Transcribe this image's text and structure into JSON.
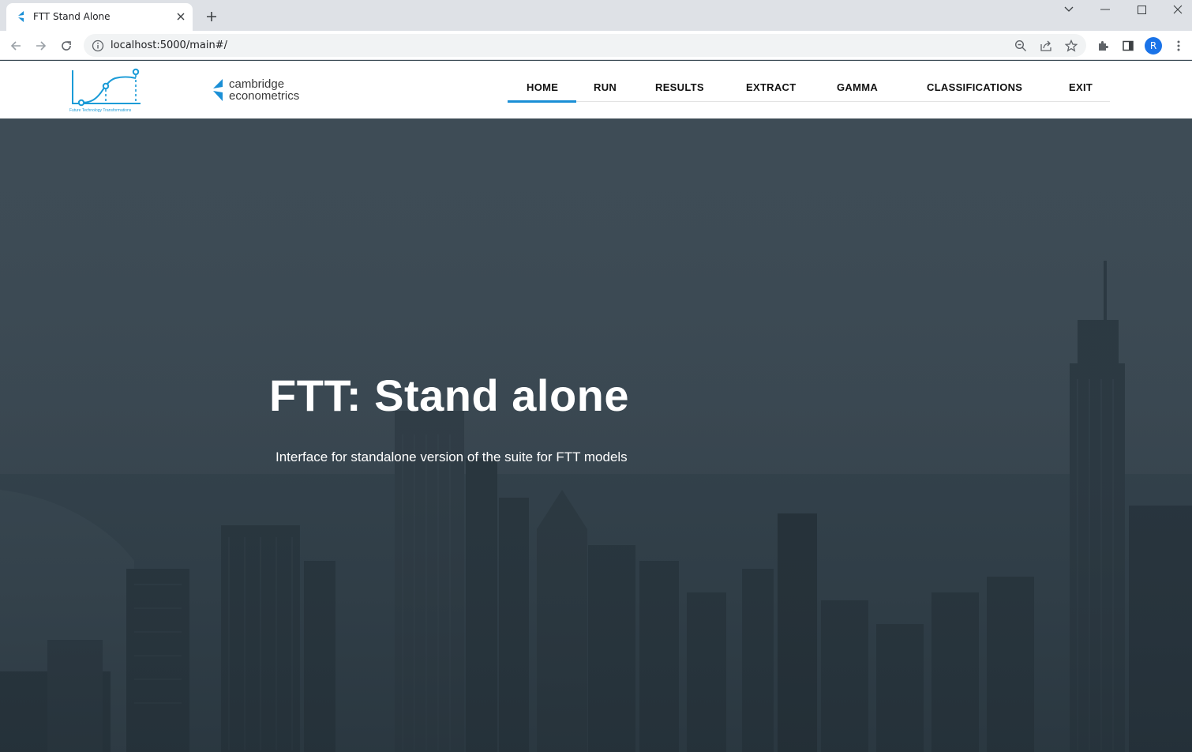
{
  "browser": {
    "tab_title": "FTT Stand Alone",
    "url": "localhost:5000/main#/",
    "profile_initial": "R"
  },
  "header": {
    "ftt_logo_caption": "Future Technology Transformations",
    "partner_logo_line1": "cambridge",
    "partner_logo_line2": "econometrics",
    "nav": {
      "home": "HOME",
      "run": "RUN",
      "results": "RESULTS",
      "extract": "EXTRACT",
      "gamma": "GAMMA",
      "classifications": "CLASSIFICATIONS",
      "exit": "EXIT"
    },
    "active_nav": "HOME",
    "accent_color": "#1a8fd6"
  },
  "hero": {
    "title": "FTT: Stand alone",
    "subtitle": "Interface for standalone version of the suite for FTT models",
    "overlay_color": "#3d4b55"
  },
  "icons": {
    "tab": [
      "ce-favicon-icon",
      "close-icon",
      "plus-icon"
    ],
    "window": [
      "chevron-down-icon",
      "minimize-icon",
      "maximize-icon",
      "close-window-icon"
    ],
    "toolbar": [
      "back-arrow-icon",
      "forward-arrow-icon",
      "reload-icon",
      "info-icon",
      "zoom-icon",
      "share-icon",
      "star-icon",
      "puzzle-icon",
      "sidebar-icon",
      "kebab-menu-icon"
    ]
  }
}
